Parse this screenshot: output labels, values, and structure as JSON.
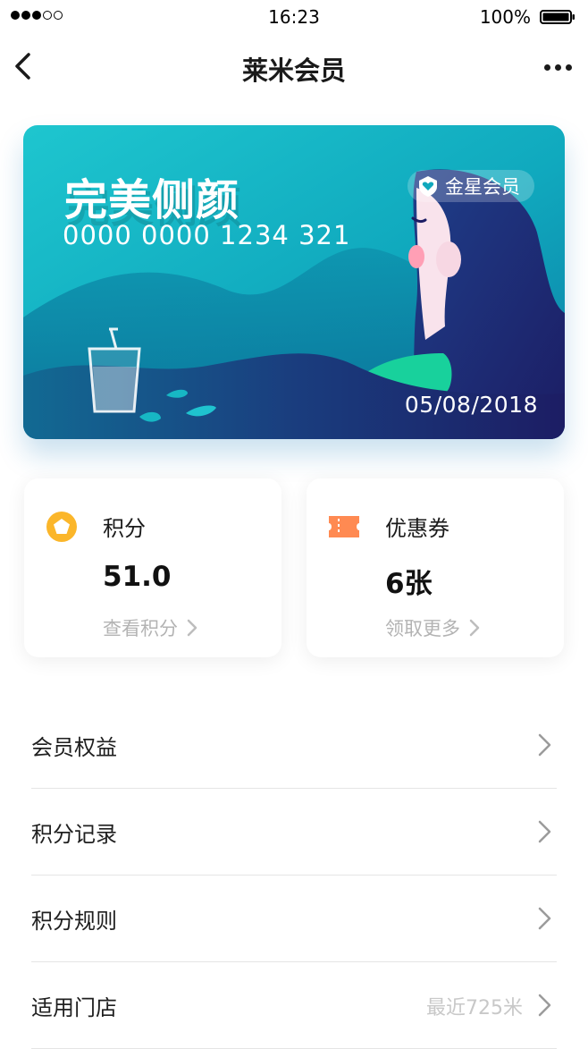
{
  "status_bar": {
    "time": "16:23",
    "battery": "100%",
    "signal_bars_filled": 3,
    "signal_bars_total": 5
  },
  "nav": {
    "title": "莱米会员",
    "back_icon": "chevron-left-icon",
    "more_icon": "more-horizontal-icon"
  },
  "card": {
    "title": "完美侧颜",
    "number": "0000 0000 1234 321",
    "badge_label": "金星会员",
    "badge_icon": "heart-shield-icon",
    "date": "05/08/2018",
    "colors": {
      "teal": "#14b9c4",
      "navy": "#1c1d64",
      "accent_green": "#18d19c"
    }
  },
  "tiles": [
    {
      "label": "积分",
      "value": "51.0",
      "link": "查看积分",
      "icon": "points-badge-icon",
      "icon_color": "#fbb62a"
    },
    {
      "label": "优惠券",
      "value": "6张",
      "link": "领取更多",
      "icon": "coupon-ticket-icon",
      "icon_color": "#ff8a52"
    }
  ],
  "list": [
    {
      "label": "会员权益",
      "extra": ""
    },
    {
      "label": "积分记录",
      "extra": ""
    },
    {
      "label": "积分规则",
      "extra": ""
    },
    {
      "label": "适用门店",
      "extra": "最近725米"
    }
  ]
}
